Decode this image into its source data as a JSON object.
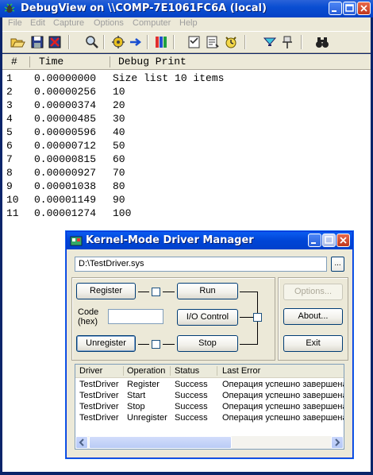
{
  "window": {
    "title": "DebugView on \\\\COMP-7E1061FC6A (local)"
  },
  "menu": [
    "File",
    "Edit",
    "Capture",
    "Options",
    "Computer",
    "Help"
  ],
  "toolbar_icons": [
    "open-icon",
    "save-icon",
    "clear-icon",
    "find-icon",
    "capture-icon",
    "autoscroll-icon",
    "filter-icon",
    "clock-icon",
    "timer-icon",
    "highlight-icon",
    "pin-icon",
    "binoculars-icon"
  ],
  "list": {
    "headers": {
      "num": "#",
      "time": "Time",
      "print": "Debug Print"
    },
    "rows": [
      {
        "num": "1",
        "time": "0.00000000",
        "print": "Size list 10 items"
      },
      {
        "num": "2",
        "time": "0.00000256",
        "print": "10"
      },
      {
        "num": "3",
        "time": "0.00000374",
        "print": "20"
      },
      {
        "num": "4",
        "time": "0.00000485",
        "print": "30"
      },
      {
        "num": "5",
        "time": "0.00000596",
        "print": "40"
      },
      {
        "num": "6",
        "time": "0.00000712",
        "print": "50"
      },
      {
        "num": "7",
        "time": "0.00000815",
        "print": "60"
      },
      {
        "num": "8",
        "time": "0.00000927",
        "print": "70"
      },
      {
        "num": "9",
        "time": "0.00001038",
        "print": "80"
      },
      {
        "num": "10",
        "time": "0.00001149",
        "print": "90"
      },
      {
        "num": "11",
        "time": "0.00001274",
        "print": "100"
      }
    ]
  },
  "dialog": {
    "title": "Kernel-Mode Driver Manager",
    "path": "D:\\TestDriver.sys",
    "browse_label": "...",
    "register_label": "Register",
    "run_label": "Run",
    "code_label_1": "Code",
    "code_label_2": "(hex)",
    "code_value": "",
    "io_control_label": "I/O Control",
    "unregister_label": "Unregister",
    "stop_label": "Stop",
    "options_label": "Options...",
    "about_label": "About...",
    "exit_label": "Exit",
    "table": {
      "headers": {
        "driver": "Driver",
        "operation": "Operation",
        "status": "Status",
        "error": "Last Error"
      },
      "rows": [
        {
          "driver": "TestDriver",
          "operation": "Register",
          "status": "Success",
          "error": "Операция успешно завершена"
        },
        {
          "driver": "TestDriver",
          "operation": "Start",
          "status": "Success",
          "error": "Операция успешно завершена"
        },
        {
          "driver": "TestDriver",
          "operation": "Stop",
          "status": "Success",
          "error": "Операция успешно завершена"
        },
        {
          "driver": "TestDriver",
          "operation": "Unregister",
          "status": "Success",
          "error": "Операция успешно завершена"
        }
      ]
    }
  }
}
